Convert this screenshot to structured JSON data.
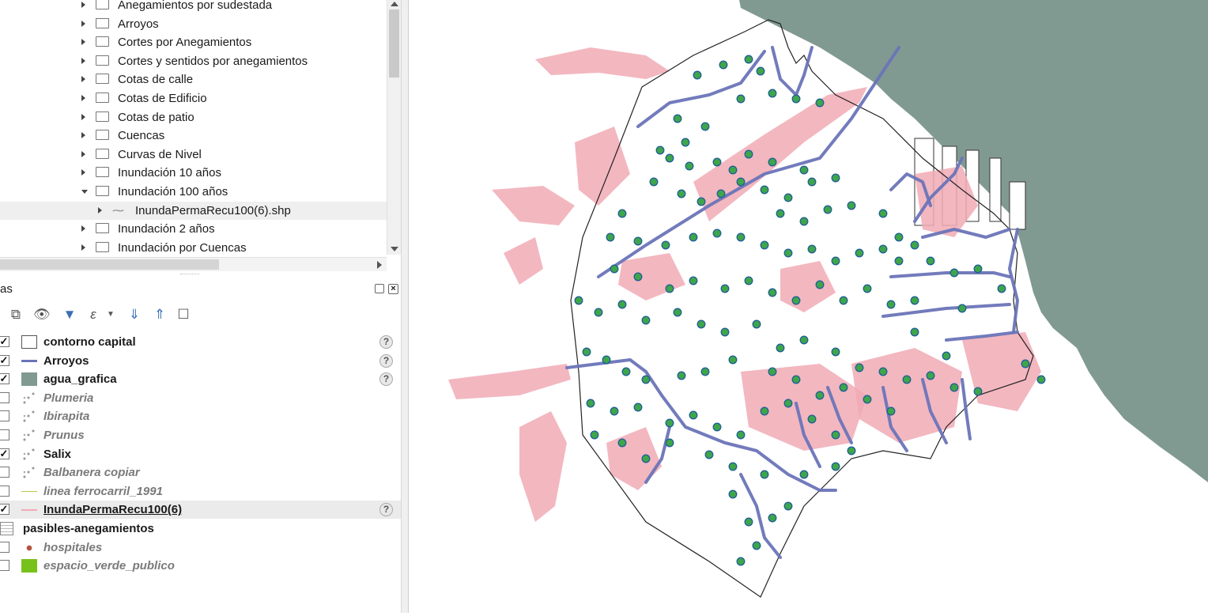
{
  "browser": {
    "items": [
      {
        "label": "Anegamientos por sudestada",
        "expanded": false
      },
      {
        "label": "Arroyos",
        "expanded": false
      },
      {
        "label": "Cortes por Anegamientos",
        "expanded": false
      },
      {
        "label": "Cortes y sentidos por anegamientos",
        "expanded": false
      },
      {
        "label": "Cotas de calle",
        "expanded": false
      },
      {
        "label": "Cotas de Edificio",
        "expanded": false
      },
      {
        "label": "Cotas de patio",
        "expanded": false
      },
      {
        "label": "Cuencas",
        "expanded": false
      },
      {
        "label": "Curvas de Nivel",
        "expanded": false
      },
      {
        "label": "Inundación 10 años",
        "expanded": false
      },
      {
        "label": "Inundación 100 años",
        "expanded": true
      },
      {
        "label": "InundaPermaRecu100(6).shp",
        "child": true,
        "selected": true
      },
      {
        "label": "Inundación 2 años",
        "expanded": false
      },
      {
        "label": "Inundación por Cuencas",
        "expanded": false
      }
    ]
  },
  "layers_panel": {
    "title": "as",
    "toolbar_icons": [
      "add-group-icon",
      "manage-visibility-icon",
      "filter-legend-icon",
      "filter-expression-icon",
      "expand-all-icon",
      "collapse-all-icon",
      "remove-layer-icon"
    ],
    "layers": [
      {
        "name": "contorno capital",
        "checked": true,
        "symbol": "polygon-white",
        "italic": false,
        "help": true
      },
      {
        "name": "Arroyos",
        "checked": true,
        "symbol": "line-blue",
        "italic": false,
        "help": true
      },
      {
        "name": "agua_grafica",
        "checked": true,
        "symbol": "polygon-gray",
        "italic": false,
        "help": true
      },
      {
        "name": "Plumeria",
        "checked": false,
        "symbol": "points",
        "italic": true,
        "help": false
      },
      {
        "name": "Ibirapita",
        "checked": false,
        "symbol": "points",
        "italic": true,
        "help": false
      },
      {
        "name": "Prunus",
        "checked": false,
        "symbol": "points",
        "italic": true,
        "help": false
      },
      {
        "name": "Salix",
        "checked": true,
        "symbol": "points",
        "italic": false,
        "help": false
      },
      {
        "name": "Balbanera copiar",
        "checked": false,
        "symbol": "points",
        "italic": true,
        "help": false
      },
      {
        "name": "linea ferrocarril_1991",
        "checked": false,
        "symbol": "line-yellowgreen",
        "italic": true,
        "help": false
      },
      {
        "name": "InundaPermaRecu100(6)",
        "checked": true,
        "symbol": "line-pink",
        "italic": false,
        "help": true,
        "selected": true,
        "underline": true
      },
      {
        "name": "pasibles-anegamientos",
        "checked": null,
        "symbol": "table",
        "italic": false,
        "help": false
      },
      {
        "name": "hospitales",
        "checked": false,
        "symbol": "dot-brown",
        "italic": true,
        "help": false
      },
      {
        "name": "espacio_verde_publico",
        "checked": false,
        "symbol": "polygon-green",
        "italic": true,
        "help": false
      }
    ],
    "help_glyph": "?"
  },
  "colors": {
    "water": "#819a91",
    "streams": "#6a74b8",
    "flood": "#f1aab5",
    "trees_fill": "#3fa54a",
    "trees_stroke": "#1f5f96",
    "outline": "#222222"
  }
}
